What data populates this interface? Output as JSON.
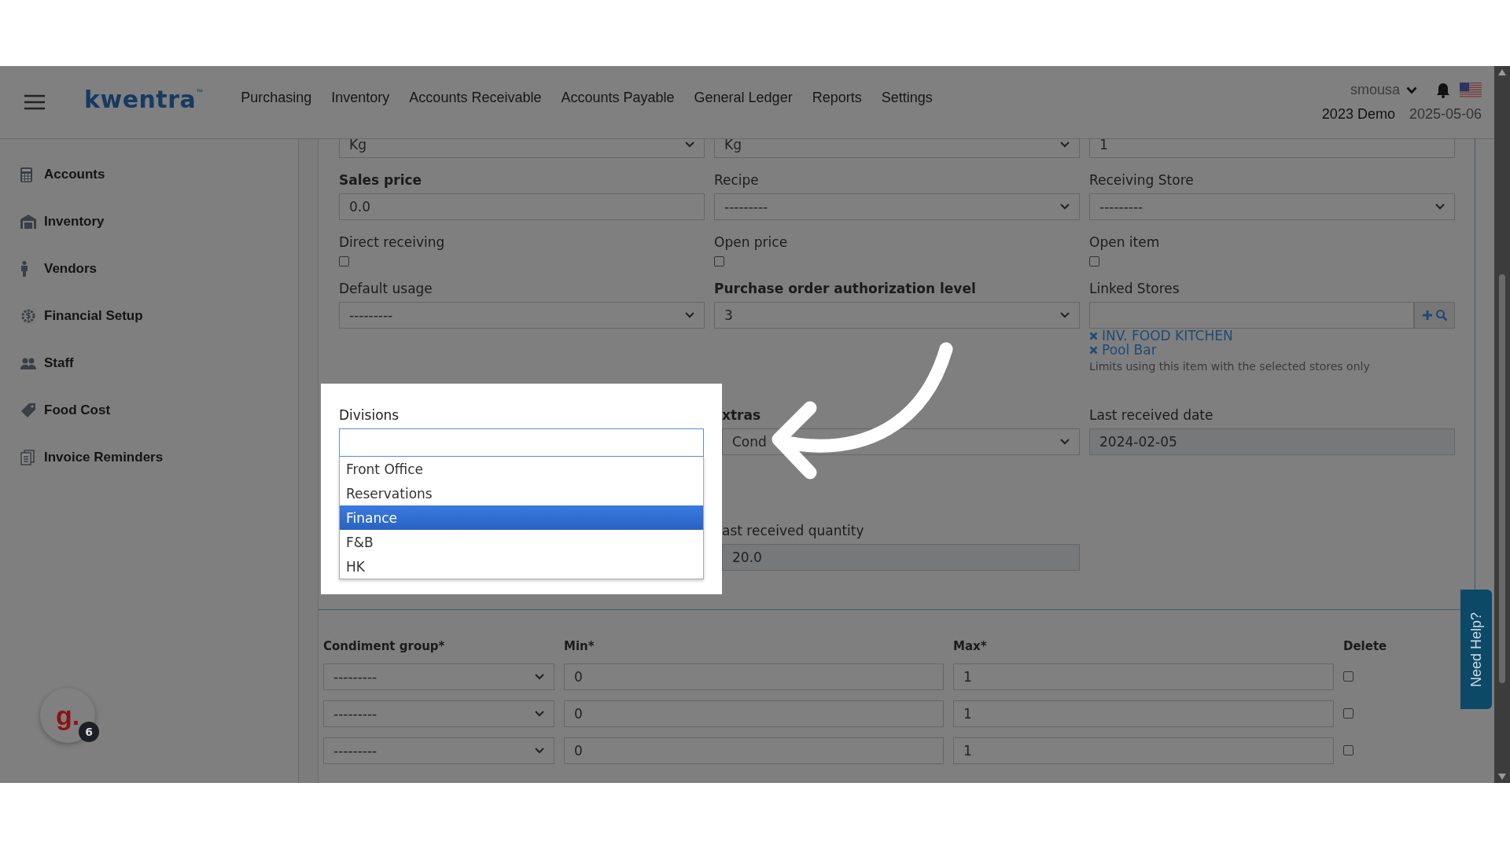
{
  "header": {
    "logo": "kwentra",
    "logo_mark": "™",
    "nav": [
      "Purchasing",
      "Inventory",
      "Accounts Receivable",
      "Accounts Payable",
      "General Ledger",
      "Reports",
      "Settings"
    ],
    "user": "smousa",
    "company": "2023 Demo",
    "date": "2025-05-06"
  },
  "sidebar": {
    "items": [
      {
        "label": "Accounts",
        "kind": "calculator"
      },
      {
        "label": "Inventory",
        "kind": "warehouse"
      },
      {
        "label": "Vendors",
        "kind": "person"
      },
      {
        "label": "Financial Setup",
        "kind": "gear"
      },
      {
        "label": "Staff",
        "kind": "users"
      },
      {
        "label": "Food Cost",
        "kind": "tag"
      },
      {
        "label": "Invoice Reminders",
        "kind": "documents"
      }
    ]
  },
  "form": {
    "top_row": [
      {
        "kind": "select",
        "value": "Kg"
      },
      {
        "kind": "select",
        "value": "Kg"
      },
      {
        "kind": "input",
        "value": "1"
      }
    ],
    "rows": [
      [
        {
          "label": "Sales price",
          "bold": true,
          "kind": "input",
          "value": "0.0"
        },
        {
          "label": "Recipe",
          "bold": false,
          "kind": "select",
          "value": "---------"
        },
        {
          "label": "Receiving Store",
          "bold": false,
          "kind": "select",
          "value": "---------"
        }
      ],
      [
        {
          "label": "Direct receiving",
          "bold": false,
          "kind": "checkbox",
          "checked": false
        },
        {
          "label": "Open price",
          "bold": false,
          "kind": "checkbox",
          "checked": false
        },
        {
          "label": "Open item",
          "bold": false,
          "kind": "checkbox",
          "checked": false
        }
      ],
      [
        {
          "label": "Default usage",
          "bold": false,
          "kind": "select",
          "value": "---------"
        },
        {
          "label": "Purchase order authorization level",
          "bold": true,
          "kind": "select",
          "value": "3"
        },
        {
          "label": "Linked Stores",
          "bold": false,
          "kind": "linked",
          "tags": [
            "INV. FOOD KITCHEN",
            "Pool Bar"
          ],
          "hint": "Limits using this item with the selected stores only"
        }
      ]
    ],
    "divisions": {
      "label": "Divisions",
      "options": [
        {
          "label": "Front Office",
          "selected": false
        },
        {
          "label": "Reservations",
          "selected": false
        },
        {
          "label": "Finance",
          "selected": true
        },
        {
          "label": "F&B",
          "selected": false
        },
        {
          "label": "HK",
          "selected": false
        }
      ]
    },
    "extras": {
      "label": "xtras",
      "value": "Cond"
    },
    "last_received_date": {
      "label": "Last received date",
      "value": "2024-02-05"
    },
    "last_received_quantity": {
      "label": "ast received quantity",
      "value": "20.0"
    }
  },
  "condiments": {
    "columns": [
      "Condiment group*",
      "Min*",
      "Max*",
      "Delete"
    ],
    "rows": [
      {
        "group": "---------",
        "min": "0",
        "max": "1",
        "delete": false
      },
      {
        "group": "---------",
        "min": "0",
        "max": "1",
        "delete": false
      },
      {
        "group": "---------",
        "min": "0",
        "max": "1",
        "delete": false
      }
    ]
  },
  "help_tab": "Need Help?",
  "chat": {
    "logo": "g.",
    "count": "6"
  }
}
